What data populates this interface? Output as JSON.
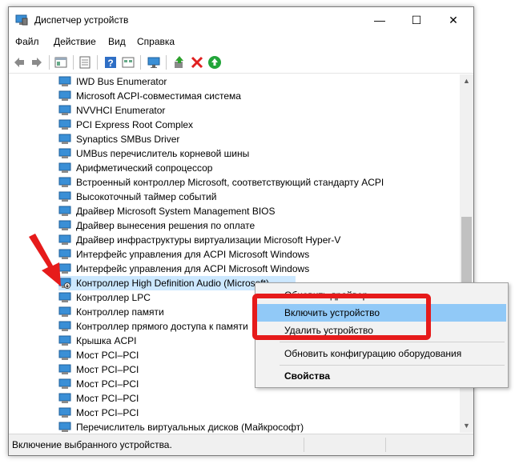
{
  "window": {
    "title": "Диспетчер устройств",
    "controls": {
      "minimize": "—",
      "maximize": "☐",
      "close": "✕"
    }
  },
  "menu": [
    "Файл",
    "Действие",
    "Вид",
    "Справка"
  ],
  "toolbar_icons": [
    "back-icon",
    "forward-icon",
    "properties-icon",
    "refresh-list-icon",
    "help-icon",
    "view-icon",
    "monitor-icon",
    "update-driver-icon",
    "uninstall-icon",
    "enable-icon"
  ],
  "devices": [
    "IWD Bus Enumerator",
    "Microsoft ACPI-совместимая система",
    "NVVHCI Enumerator",
    "PCI Express Root Complex",
    "Synaptics SMBus Driver",
    "UMBus перечислитель корневой шины",
    "Арифметический сопроцессор",
    "Встроенный контроллер Microsoft, соответствующий стандарту ACPI",
    "Высокоточный таймер событий",
    "Драйвер Microsoft System Management BIOS",
    "Драйвер вынесения решения по оплате",
    "Драйвер инфраструктуры виртуализации Microsoft Hyper-V",
    "Интерфейс управления для ACPI Microsoft Windows",
    "Интерфейс управления для ACPI Microsoft Windows",
    "Контроллер High Definition Audio (Microsoft)",
    "Контроллер LPC",
    "Контроллер памяти",
    "Контроллер прямого доступа к памяти",
    "Крышка ACPI",
    "Мост PCI–PCI",
    "Мост PCI–PCI",
    "Мост PCI–PCI",
    "Мост PCI–PCI",
    "Мост PCI–PCI",
    "Перечислитель виртуальных дисков (Майкрософт)"
  ],
  "selected_device_index": 14,
  "context_menu": {
    "items": [
      {
        "label": "Обновить драйвер",
        "highlighted": false
      },
      {
        "label": "Включить устройство",
        "highlighted": true
      },
      {
        "label": "Удалить устройство",
        "highlighted": false
      },
      {
        "label": "Обновить конфигурацию оборудования",
        "highlighted": false
      },
      {
        "label": "Свойства",
        "highlighted": false,
        "bold": true
      }
    ]
  },
  "status": "Включение выбранного устройства.",
  "colors": {
    "selection": "#cce8ff",
    "menu_highlight": "#91c9f7",
    "annotation_red": "#e61b1b"
  }
}
